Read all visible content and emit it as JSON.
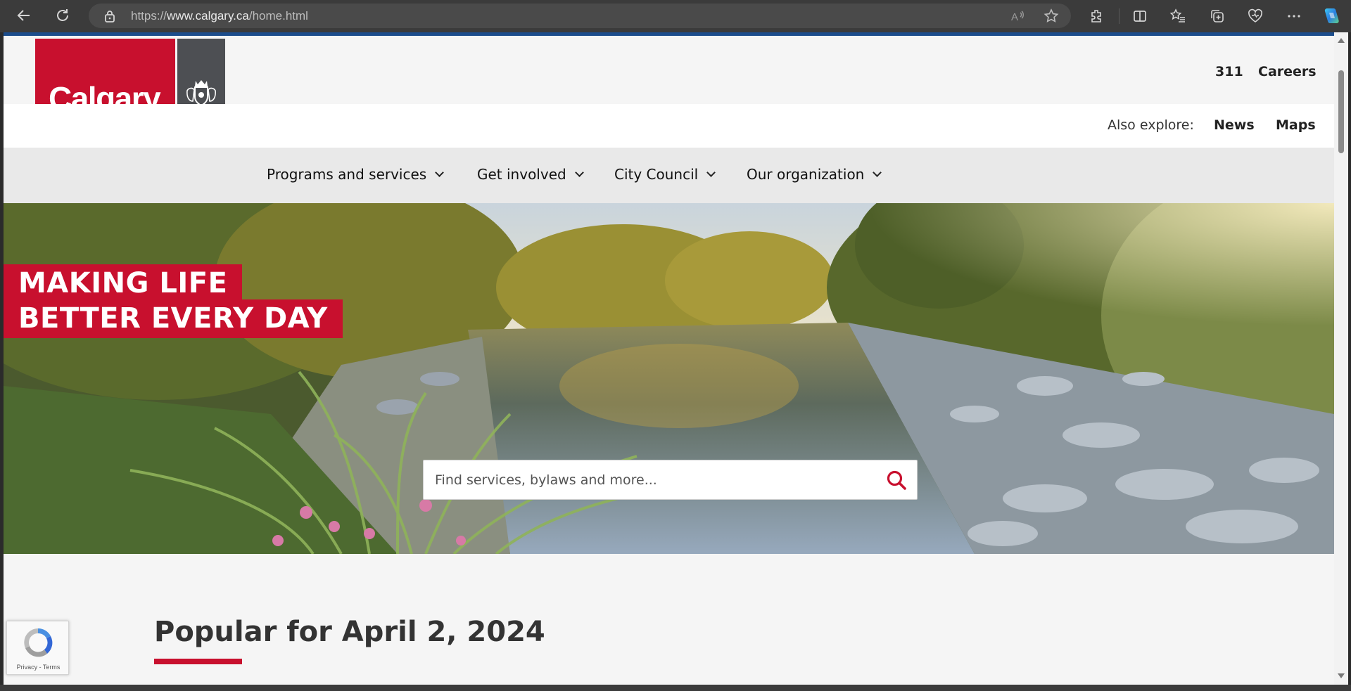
{
  "browser": {
    "url_prefix": "https://",
    "url_host": "www.calgary.ca",
    "url_path": "/home.html",
    "icons": [
      "back-icon",
      "refresh-icon",
      "lock-icon",
      "read-aloud-icon",
      "favorite-star-icon",
      "extensions-icon",
      "split-screen-icon",
      "favorites-icon",
      "collections-icon",
      "browser-essentials-icon",
      "more-icon",
      "copilot-icon"
    ]
  },
  "header": {
    "logo_text": "Calgary",
    "util_links": [
      "311",
      "Careers"
    ],
    "also_explore_label": "Also explore:",
    "also_links": [
      "News",
      "Maps"
    ]
  },
  "nav": {
    "items": [
      {
        "label": "Programs and services"
      },
      {
        "label": "Get involved"
      },
      {
        "label": "City Council"
      },
      {
        "label": "Our organization"
      }
    ]
  },
  "hero": {
    "tagline_1": "MAKING LIFE",
    "tagline_2": "BETTER EVERY DAY",
    "search_placeholder": "Find services, bylaws and more..."
  },
  "main": {
    "popular_heading": "Popular for April 2, 2024"
  },
  "recaptcha": {
    "links": "Privacy - Terms"
  },
  "colors": {
    "brand_red": "#c8102e",
    "logo_grey": "#4d4f53",
    "nav_bg": "#e9e9e9",
    "page_bg": "#f5f5f5"
  }
}
